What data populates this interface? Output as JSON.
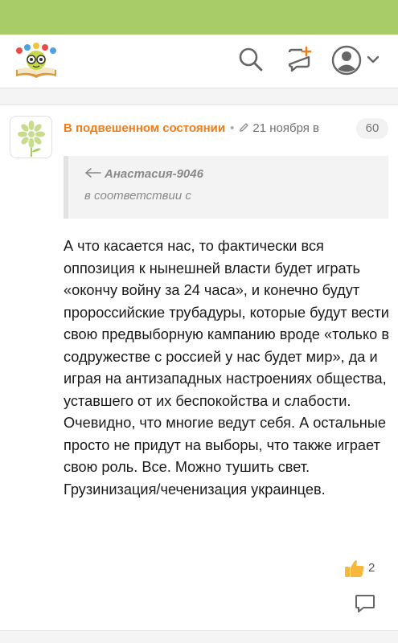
{
  "header": {
    "logo": "site-logo-bee-book",
    "icons": [
      "search-icon",
      "new-post-icon",
      "account-icon",
      "chevron-down-icon"
    ]
  },
  "post": {
    "author": "В подвешенном состоянии",
    "separator": "•",
    "date": "21 ноября в",
    "comment_count": "60",
    "quote": {
      "author": "Анастасия-9046",
      "text": "в соответствии с"
    },
    "body": "А что касается нас, то фактически вся оппозиция к нынешней власти будет играть «окончу войну за 24 часа», и конечно будут пророссийские трубадуры, которые будут вести свою предвыборную кампанию вроде «только в содружестве с россией у нас будет мир», да и играя на антизападных настроениях общества, уставшего от их беспокойства и слабости. Очевидно, что многие ведут себя. А остальные просто не придут на выборы, что также играет свою роль. Все. Можно тушить свет. Грузинизация/чеченизация украинцев.",
    "likes": "2"
  },
  "colors": {
    "topbar": "#a7cc68",
    "author": "#f07d1a",
    "like": "#f5b83a"
  }
}
